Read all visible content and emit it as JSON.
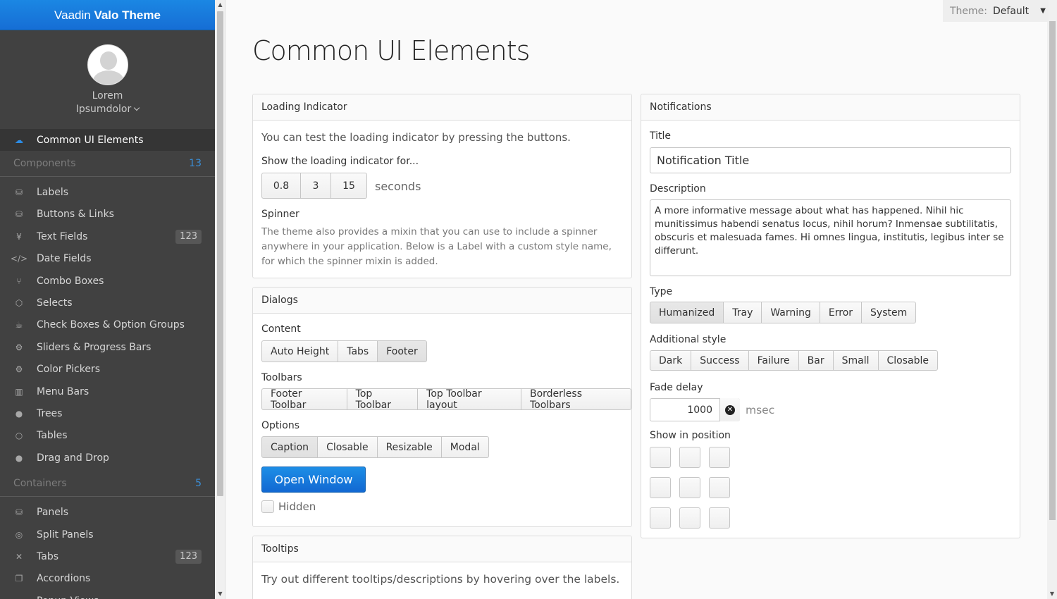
{
  "sidebar": {
    "title_light": "Vaadin ",
    "title_bold": "Valo Theme",
    "user": {
      "first": "Lorem",
      "last": "Ipsumdolor"
    },
    "selected": {
      "label": "Common UI Elements",
      "icon": "cloud-icon"
    },
    "components_section": {
      "label": "Components",
      "count": "13"
    },
    "components": [
      {
        "label": "Labels",
        "icon": "database-icon",
        "badge": ""
      },
      {
        "label": "Buttons & Links",
        "icon": "database-icon",
        "badge": ""
      },
      {
        "label": "Text Fields",
        "icon": "yen-icon",
        "badge": "123"
      },
      {
        "label": "Date Fields",
        "icon": "code-icon",
        "badge": ""
      },
      {
        "label": "Combo Boxes",
        "icon": "branch-icon",
        "badge": ""
      },
      {
        "label": "Selects",
        "icon": "cubes-icon",
        "badge": ""
      },
      {
        "label": "Check Boxes & Option Groups",
        "icon": "coffee-icon",
        "badge": ""
      },
      {
        "label": "Sliders & Progress Bars",
        "icon": "gear-icon",
        "badge": ""
      },
      {
        "label": "Color Pickers",
        "icon": "cogs-icon",
        "badge": ""
      },
      {
        "label": "Menu Bars",
        "icon": "columns-icon",
        "badge": ""
      },
      {
        "label": "Trees",
        "icon": "comment-icon",
        "badge": ""
      },
      {
        "label": "Tables",
        "icon": "comment-outline-icon",
        "badge": ""
      },
      {
        "label": "Drag and Drop",
        "icon": "comments-icon",
        "badge": ""
      }
    ],
    "containers_section": {
      "label": "Containers",
      "count": "5"
    },
    "containers": [
      {
        "label": "Panels",
        "icon": "database-icon",
        "badge": ""
      },
      {
        "label": "Split Panels",
        "icon": "compass-icon",
        "badge": ""
      },
      {
        "label": "Tabs",
        "icon": "compress-icon",
        "badge": "123"
      },
      {
        "label": "Accordions",
        "icon": "copy-icon",
        "badge": ""
      },
      {
        "label": "Popup Views",
        "icon": "credit-card-icon",
        "badge": ""
      }
    ]
  },
  "theme": {
    "label": "Theme:",
    "value": "Default"
  },
  "page_title": "Common UI Elements",
  "loading": {
    "header": "Loading Indicator",
    "desc": "You can test the loading indicator by pressing the buttons.",
    "show_caption": "Show the loading indicator for...",
    "buttons": [
      "0.8",
      "3",
      "15"
    ],
    "unit": "seconds",
    "spinner_caption": "Spinner",
    "spinner_desc": "The theme also provides a mixin that you can use to include a spinner anywhere in your application. Below is a Label with a custom style name, for which the spinner mixin is added."
  },
  "dialogs": {
    "header": "Dialogs",
    "content_caption": "Content",
    "content_buttons": [
      "Auto Height",
      "Tabs",
      "Footer"
    ],
    "toolbars_caption": "Toolbars",
    "toolbar_buttons": [
      "Footer Toolbar",
      "Top Toolbar",
      "Top Toolbar layout",
      "Borderless Toolbars"
    ],
    "options_caption": "Options",
    "option_buttons": [
      "Caption",
      "Closable",
      "Resizable",
      "Modal"
    ],
    "open_button": "Open Window",
    "hidden_label": "Hidden"
  },
  "tooltips": {
    "header": "Tooltips",
    "desc": "Try out different tooltips/descriptions by hovering over the labels."
  },
  "notifications": {
    "header": "Notifications",
    "title_caption": "Title",
    "title_value": "Notification Title",
    "desc_caption": "Description",
    "desc_value": "A more informative message about what has happened. Nihil hic munitissimus habendi senatus locus, nihil horum? Inmensae subtilitatis, obscuris et malesuada fames. Hi omnes lingua, institutis, legibus inter se differunt.",
    "type_caption": "Type",
    "type_buttons": [
      "Humanized",
      "Tray",
      "Warning",
      "Error",
      "System"
    ],
    "style_caption": "Additional style",
    "style_buttons": [
      "Dark",
      "Success",
      "Failure",
      "Bar",
      "Small",
      "Closable"
    ],
    "delay_caption": "Fade delay",
    "delay_value": "1000",
    "delay_unit": "msec",
    "position_caption": "Show in position"
  }
}
